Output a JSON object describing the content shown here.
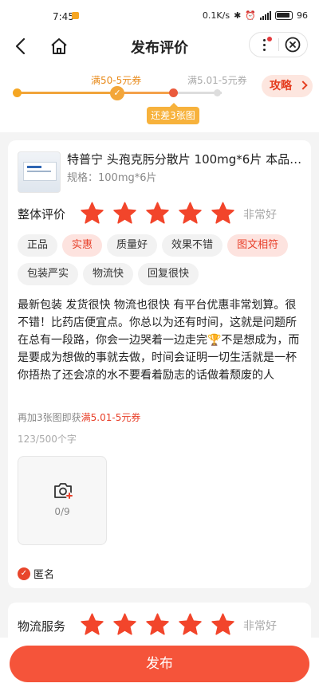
{
  "status_bar": {
    "time": "7:45",
    "net": "0.1K/s",
    "battery": "96"
  },
  "nav": {
    "title": "发布评价"
  },
  "coupon_progress": {
    "label_reached": "满50-5元券",
    "label_next": "满5.01-5元券",
    "tip": "还差3张图",
    "strategy": "攻略"
  },
  "product": {
    "name": "特普宁 头孢克肟分散片 100mg*6片 本品…",
    "spec": "规格：100mg*6片"
  },
  "overall": {
    "label": "整体评价",
    "stars": 5,
    "rating_text": "非常好"
  },
  "tags": [
    {
      "label": "正品",
      "selected": false
    },
    {
      "label": "实惠",
      "selected": true
    },
    {
      "label": "质量好",
      "selected": false
    },
    {
      "label": "效果不错",
      "selected": false
    },
    {
      "label": "图文相符",
      "selected": true
    },
    {
      "label": "包装严实",
      "selected": false
    },
    {
      "label": "物流快",
      "selected": false
    },
    {
      "label": "回复很快",
      "selected": false
    }
  ],
  "review_text": "最新包装 发货很快 物流也很快 有平台优惠非常划算。很不错！比药店便宜点。你总以为还有时间，这就是问题所在总有一段路，你会一边哭着一边走完🏆不是想成为，而是要成为想做的事就去做，时间会证明一切生活就是一杯你捂热了还会凉的水不要看着励志的话做着颓废的人",
  "bonus": {
    "prefix": "再加3张图即获",
    "highlight": "满5.01-5元券"
  },
  "char_count": "123/500个字",
  "upload": {
    "count": "0/9"
  },
  "anonymous": {
    "label": "匿名",
    "checked": true
  },
  "logistics": {
    "label": "物流服务",
    "stars": 5,
    "rating_text": "非常好"
  },
  "publish_label": "发布",
  "colors": {
    "accent": "#f5543a",
    "star": "#f2452b",
    "coupon_orange": "#e88a1a"
  }
}
